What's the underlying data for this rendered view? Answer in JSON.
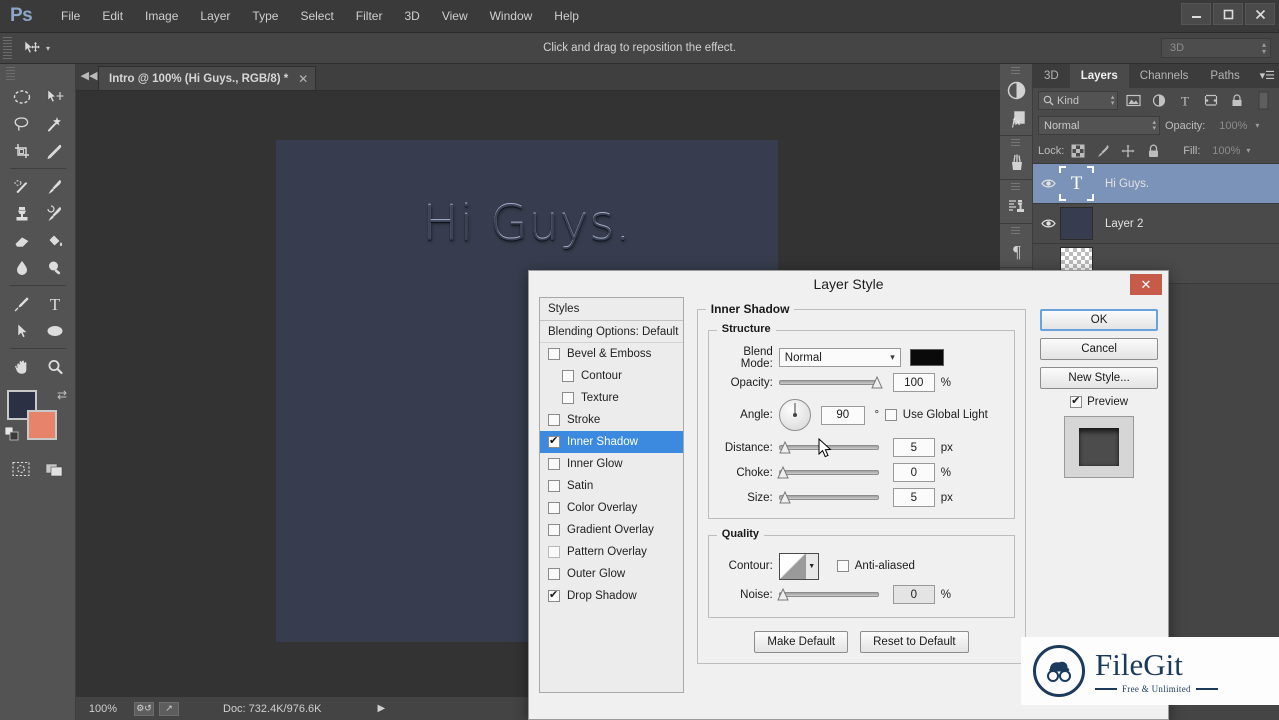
{
  "app": {
    "logo": "Ps",
    "menus": [
      "File",
      "Edit",
      "Image",
      "Layer",
      "Type",
      "Select",
      "Filter",
      "3D",
      "View",
      "Window",
      "Help"
    ],
    "window_controls": {
      "minimize": "—",
      "maximize": "❐",
      "close": "✕"
    }
  },
  "options_bar": {
    "hint": "Click and drag to reposition the effect.",
    "workspace": "3D"
  },
  "toolbar": {
    "tools": [
      "marquee-elliptical-tool",
      "move-tool",
      "lasso-tool",
      "magic-wand-tool",
      "crop-tool",
      "eyedropper-tool",
      "spot-healing-brush-tool",
      "brush-tool",
      "clone-stamp-tool",
      "history-brush-tool",
      "eraser-tool",
      "paint-bucket-tool",
      "blur-tool",
      "dodge-tool",
      "pen-tool",
      "type-tool",
      "path-selection-tool",
      "ellipse-shape-tool",
      "hand-tool",
      "zoom-tool"
    ],
    "foreground_color": "#2b3044",
    "background_color": "#e8836b",
    "bottom_tools": [
      "quick-mask-tool",
      "screen-mode-tool"
    ]
  },
  "document": {
    "tab_title": "Intro @ 100% (Hi Guys., RGB/8) *",
    "canvas_text": "Hi Guys.",
    "canvas_bg": "#373d4e"
  },
  "status_bar": {
    "zoom": "100%",
    "doc_info": "Doc: 732.4K/976.6K",
    "arrow": "▶"
  },
  "icon_dock": {
    "icons": [
      "adjustments-icon",
      "styles-fx-icon",
      "brushes-icon",
      "clone-source-icon",
      "paragraph-icon"
    ]
  },
  "layers_panel": {
    "tabs": [
      "3D",
      "Layers",
      "Channels",
      "Paths"
    ],
    "active_tab": "Layers",
    "menu_icon": "panel-menu-icon",
    "filter": {
      "kind_label": "Kind",
      "filter_icons": [
        "pixel-filter-icon",
        "adjustment-filter-icon",
        "type-filter-icon",
        "shape-filter-icon",
        "smart-object-filter-icon"
      ]
    },
    "blend_mode": "Normal",
    "opacity_label": "Opacity:",
    "opacity_value": "100%",
    "lock_label": "Lock:",
    "lock_icons": [
      "lock-transparent-icon",
      "lock-image-icon",
      "lock-position-icon",
      "lock-all-icon"
    ],
    "fill_label": "Fill:",
    "fill_value": "100%",
    "layers": [
      {
        "name": "Hi Guys.",
        "type": "text",
        "visible": true,
        "selected": true
      },
      {
        "name": "Layer 2",
        "type": "pixel",
        "visible": true,
        "selected": false
      },
      {
        "name": "",
        "type": "transparent",
        "visible": false,
        "selected": false
      }
    ]
  },
  "dialog": {
    "title": "Layer Style",
    "close_label": "✕",
    "styles_header": "Styles",
    "blending_options": "Blending Options: Default",
    "style_items": [
      {
        "label": "Bevel & Emboss",
        "checked": false,
        "indent": false,
        "active": false
      },
      {
        "label": "Contour",
        "checked": false,
        "indent": true,
        "active": false
      },
      {
        "label": "Texture",
        "checked": false,
        "indent": true,
        "active": false
      },
      {
        "label": "Stroke",
        "checked": false,
        "indent": false,
        "active": false
      },
      {
        "label": "Inner Shadow",
        "checked": true,
        "indent": false,
        "active": true
      },
      {
        "label": "Inner Glow",
        "checked": false,
        "indent": false,
        "active": false
      },
      {
        "label": "Satin",
        "checked": false,
        "indent": false,
        "active": false
      },
      {
        "label": "Color Overlay",
        "checked": false,
        "indent": false,
        "active": false
      },
      {
        "label": "Gradient Overlay",
        "checked": false,
        "indent": false,
        "active": false
      },
      {
        "label": "Pattern Overlay",
        "checked": false,
        "indent": false,
        "active": false
      },
      {
        "label": "Outer Glow",
        "checked": false,
        "indent": false,
        "active": false
      },
      {
        "label": "Drop Shadow",
        "checked": true,
        "indent": false,
        "active": false
      }
    ],
    "section_title": "Inner Shadow",
    "structure": {
      "legend": "Structure",
      "blend_mode_label": "Blend Mode:",
      "blend_mode_value": "Normal",
      "shadow_color": "#0a0a0a",
      "opacity_label": "Opacity:",
      "opacity_value": "100",
      "opacity_unit": "%",
      "angle_label": "Angle:",
      "angle_value": "90",
      "angle_unit": "°",
      "use_global_light": "Use Global Light",
      "use_global_light_checked": false,
      "distance_label": "Distance:",
      "distance_value": "5",
      "distance_unit": "px",
      "choke_label": "Choke:",
      "choke_value": "0",
      "choke_unit": "%",
      "size_label": "Size:",
      "size_value": "5",
      "size_unit": "px"
    },
    "quality": {
      "legend": "Quality",
      "contour_label": "Contour:",
      "anti_aliased_label": "Anti-aliased",
      "anti_aliased_checked": false,
      "noise_label": "Noise:",
      "noise_value": "0",
      "noise_unit": "%"
    },
    "make_default": "Make Default",
    "reset_to_default": "Reset to Default",
    "ok": "OK",
    "cancel": "Cancel",
    "new_style": "New Style...",
    "preview_label": "Preview",
    "preview_checked": true,
    "accent_selected": "#3c8ae0"
  },
  "watermark": {
    "name": "FileGit",
    "tagline": "Free & Unlimited"
  }
}
